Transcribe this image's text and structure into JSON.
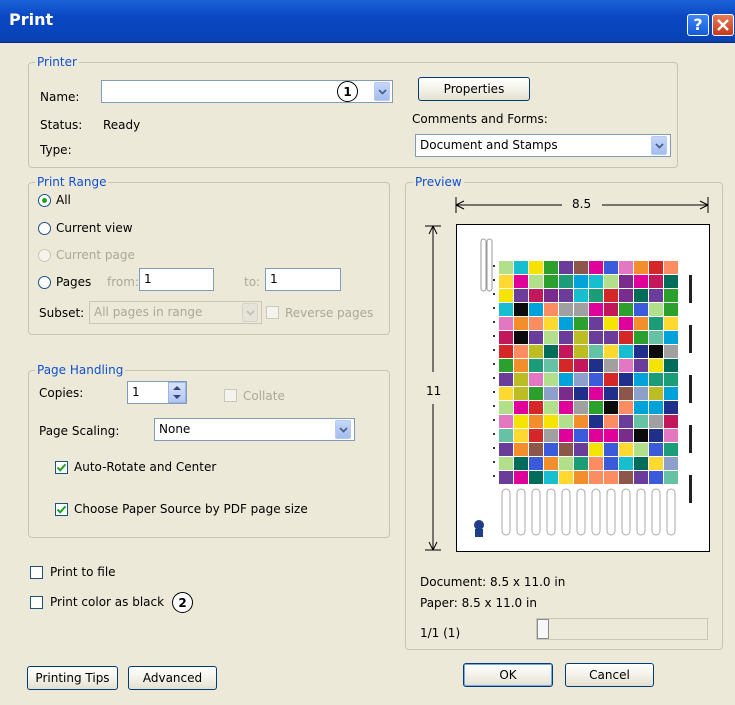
{
  "window": {
    "title": "Print",
    "help_glyph": "?"
  },
  "printer": {
    "legend": "Printer",
    "name_label": "Name:",
    "name_value": "",
    "status_label": "Status:",
    "status_value": "Ready",
    "type_label": "Type:",
    "type_value": "",
    "properties_label": "Properties",
    "comments_label": "Comments and Forms:",
    "comments_value": "Document and Stamps",
    "callout_1": "1"
  },
  "print_range": {
    "legend": "Print Range",
    "all_label": "All",
    "current_view_label": "Current view",
    "current_page_label": "Current page",
    "pages_label": "Pages",
    "from_label": "from:",
    "from_value": "1",
    "to_label": "to:",
    "to_value": "1",
    "subset_label": "Subset:",
    "subset_value": "All pages in range",
    "reverse_label": "Reverse pages"
  },
  "page_handling": {
    "legend": "Page Handling",
    "copies_label": "Copies:",
    "copies_value": "1",
    "collate_label": "Collate",
    "scaling_label": "Page Scaling:",
    "scaling_value": "None",
    "auto_rotate_label": "Auto-Rotate and Center",
    "paper_source_label": "Choose Paper Source by PDF page size"
  },
  "print_to_file_label": "Print to file",
  "print_color_black_label": "Print color as black",
  "callout_2": "2",
  "preview": {
    "legend": "Preview",
    "width_label": "8.5",
    "height_label": "11",
    "document_size": "Document: 8.5 x 11.0 in",
    "paper_size": "Paper: 8.5 x 11.0 in",
    "page_count": "1/1 (1)",
    "page_position": 0
  },
  "buttons": {
    "tips": "Printing Tips",
    "advanced": "Advanced",
    "ok": "OK",
    "cancel": "Cancel"
  },
  "colors": {
    "title_bar": "#0a47c2",
    "legend_text": "#1050d0",
    "dialog_bg": "#ECE9D8"
  }
}
